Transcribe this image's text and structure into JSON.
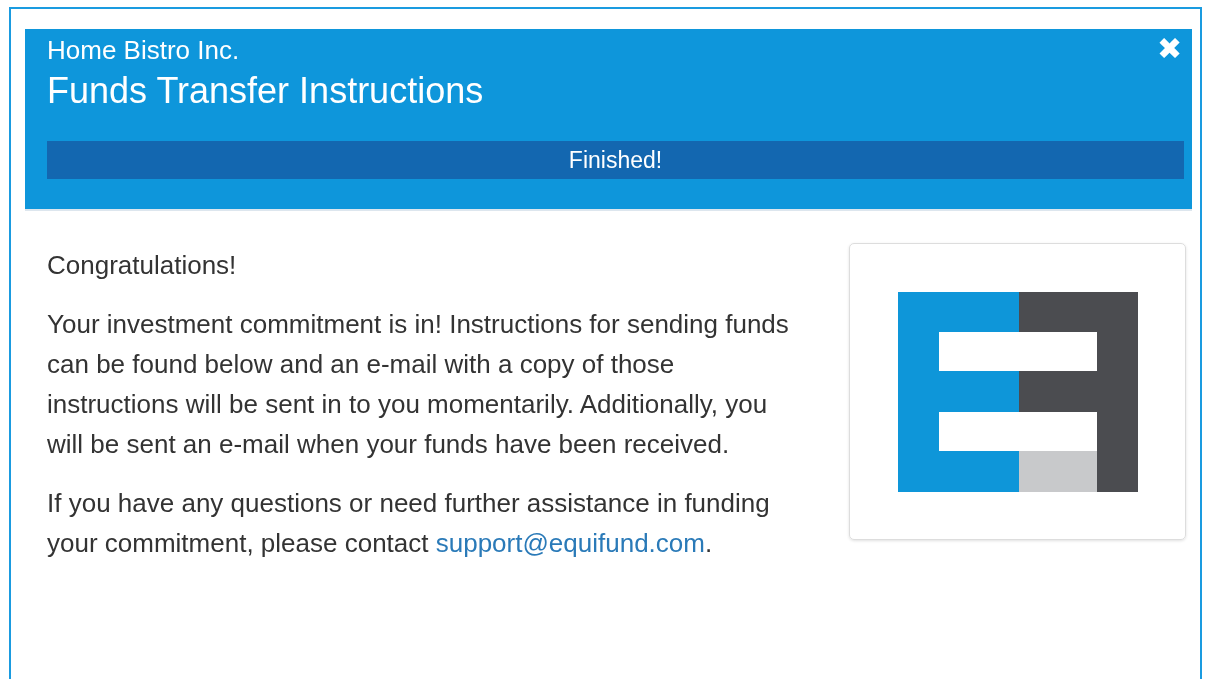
{
  "header": {
    "company": "Home Bistro Inc.",
    "title": "Funds Transfer Instructions",
    "close": "✖"
  },
  "progress": {
    "label": "Finished!",
    "level": 1
  },
  "body": {
    "greeting": "Congratulations!",
    "paragraph": "Your investment commitment is in! Instructions for sending funds can be found below and an e-mail with a copy of those instructions will be sent in to you momentarily. Additionally, you will be sent an e-mail when your funds have been received.",
    "contact": {
      "text": "If you have any questions or need further assistance in funding your commitment, please contact ",
      "link": "support@equifund.com",
      "after": "."
    }
  }
}
